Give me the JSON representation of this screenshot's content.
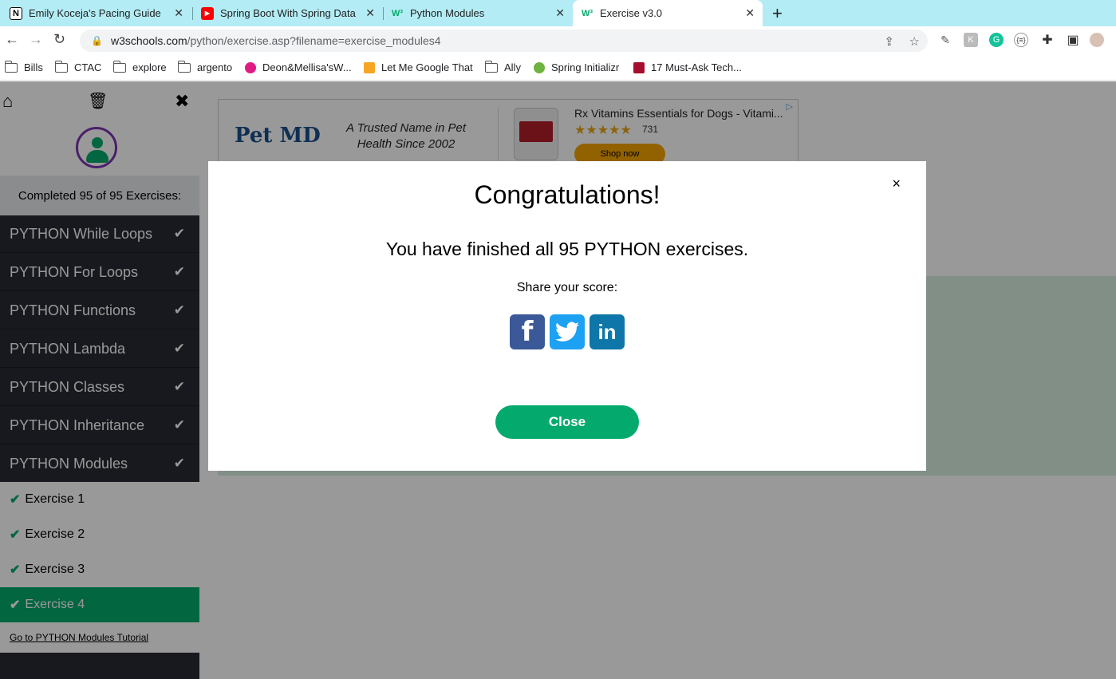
{
  "browser": {
    "tabs": [
      {
        "title": "Emily Koceja's Pacing Guide",
        "icon": "notion-icon"
      },
      {
        "title": "Spring Boot With Spring Data J",
        "icon": "youtube-icon"
      },
      {
        "title": "Python Modules",
        "icon": "w3schools-icon"
      },
      {
        "title": "Exercise v3.0",
        "icon": "w3schools-icon"
      }
    ],
    "url_host": "w3schools.com",
    "url_path": "/python/exercise.asp?filename=exercise_modules4",
    "bookmarks": [
      "Bills",
      "CTAC",
      "explore",
      "argento",
      "Deon&Mellisa'sW...",
      "Let Me Google That",
      "Ally",
      "Spring Initializr",
      "17 Must-Ask Tech..."
    ]
  },
  "sidebar": {
    "completed_text": "Completed 95 of 95 Exercises:",
    "sections": [
      "PYTHON While Loops",
      "PYTHON For Loops",
      "PYTHON Functions",
      "PYTHON Lambda",
      "PYTHON Classes",
      "PYTHON Inheritance",
      "PYTHON Modules"
    ],
    "exercises": [
      "Exercise 1",
      "Exercise 2",
      "Exercise 3",
      "Exercise 4"
    ],
    "tutorial_link": "Go to PYTHON Modules Tutorial"
  },
  "ad": {
    "brand": "Pet MD",
    "tagline": "A Trusted Name in Pet Health Since 2002",
    "product_title": "Rx Vitamins Essentials for Dogs - Vitami...",
    "stars": "★★★★★",
    "rating_count": "731",
    "cta": "Shop now"
  },
  "modal": {
    "title": "Congratulations!",
    "message": "You have finished all 95 PYTHON exercises.",
    "share_label": "Share your score:",
    "close_label": "Close",
    "close_x": "×"
  },
  "colors": {
    "accent": "#04aa6d",
    "sidebar_bg": "#282a35",
    "tabbar_bg": "#b3ecf5"
  }
}
